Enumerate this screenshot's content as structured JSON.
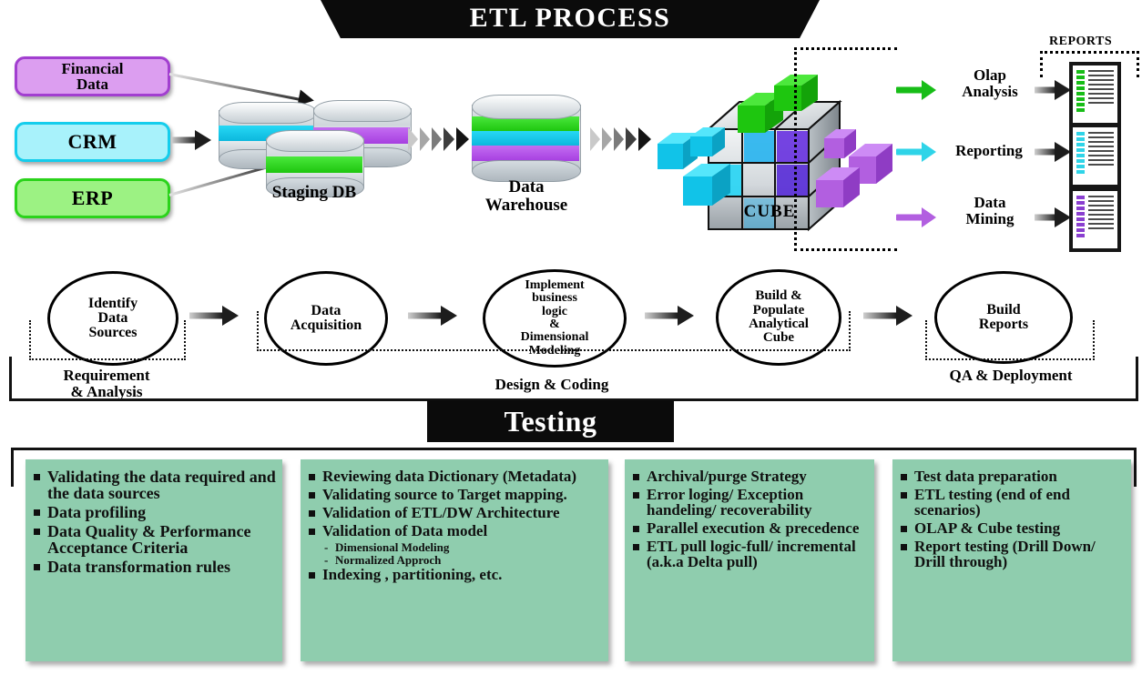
{
  "header": {
    "title": "ETL PROCESS"
  },
  "sources": [
    {
      "label": "Financial\nData",
      "fill": "#dc9ef0",
      "border": "#a23fd0"
    },
    {
      "label": "CRM",
      "fill": "#a8f2fb",
      "border": "#14cdec"
    },
    {
      "label": "ERP",
      "fill": "#9cf283",
      "border": "#2bd31b"
    }
  ],
  "pipeline": {
    "staging_label": "Staging DB",
    "warehouse_label": "Data\nWarehouse",
    "cube_label": "CUBE"
  },
  "outputs": [
    {
      "label": "Olap\nAnalysis",
      "color": "#17bd17"
    },
    {
      "label": "Reporting",
      "color": "#2fd4e8"
    },
    {
      "label": "Data\nMining",
      "color": "#b25fe0"
    }
  ],
  "reports": {
    "title": "REPORTS",
    "sheets": [
      {
        "tick_color": "#17bd17"
      },
      {
        "tick_color": "#2fd4e8"
      },
      {
        "tick_color": "#8a3fd0"
      }
    ]
  },
  "process_steps": [
    {
      "label": "Identify\nData\nSources"
    },
    {
      "label": "Data\nAcquisition"
    },
    {
      "label": "Implement\nbusiness\nlogic\n&\nDimensional\nModeling"
    },
    {
      "label": "Build &\nPopulate\nAnalytical\nCube"
    },
    {
      "label": "Build\nReports"
    }
  ],
  "phases": [
    {
      "label": "Requirement\n& Analysis"
    },
    {
      "label": "Design & Coding"
    },
    {
      "label": "QA & Deployment"
    }
  ],
  "testing": {
    "title": "Testing",
    "columns": [
      {
        "items": [
          {
            "text": "Validating the data required and the data sources",
            "sub": false
          },
          {
            "text": "Data profiling",
            "sub": false
          },
          {
            "text": "Data Quality & Performance Acceptance Criteria",
            "sub": false
          },
          {
            "text": "Data transformation rules",
            "sub": false
          }
        ]
      },
      {
        "items": [
          {
            "text": "Reviewing data Dictionary (Metadata)",
            "sub": false
          },
          {
            "text": "Validating source to Target mapping.",
            "sub": false
          },
          {
            "text": "Validation of ETL/DW Architecture",
            "sub": false
          },
          {
            "text": "Validation of Data model",
            "sub": false
          },
          {
            "text": "Dimensional Modeling",
            "sub": true
          },
          {
            "text": "Normalized Approch",
            "sub": true
          },
          {
            "text": "Indexing , partitioning, etc.",
            "sub": false
          }
        ]
      },
      {
        "items": [
          {
            "text": "Archival/purge Strategy",
            "sub": false
          },
          {
            "text": "Error loging/ Exception handeling/ recoverability",
            "sub": false
          },
          {
            "text": "Parallel execution & precedence",
            "sub": false
          },
          {
            "text": "ETL pull logic-full/ incremental (a.k.a Delta pull)",
            "sub": false
          }
        ]
      },
      {
        "items": [
          {
            "text": "Test data preparation",
            "sub": false
          },
          {
            "text": "ETL testing (end of end scenarios)",
            "sub": false
          },
          {
            "text": "OLAP & Cube testing",
            "sub": false
          },
          {
            "text": "Report testing (Drill Down/ Drill through)",
            "sub": false
          }
        ]
      }
    ]
  },
  "colors": {
    "banner_bg": "#0b0b0b",
    "testing_box": "#8fcdae",
    "green": "#17bd17",
    "cyan": "#2fd4e8",
    "purple": "#b25fe0"
  }
}
